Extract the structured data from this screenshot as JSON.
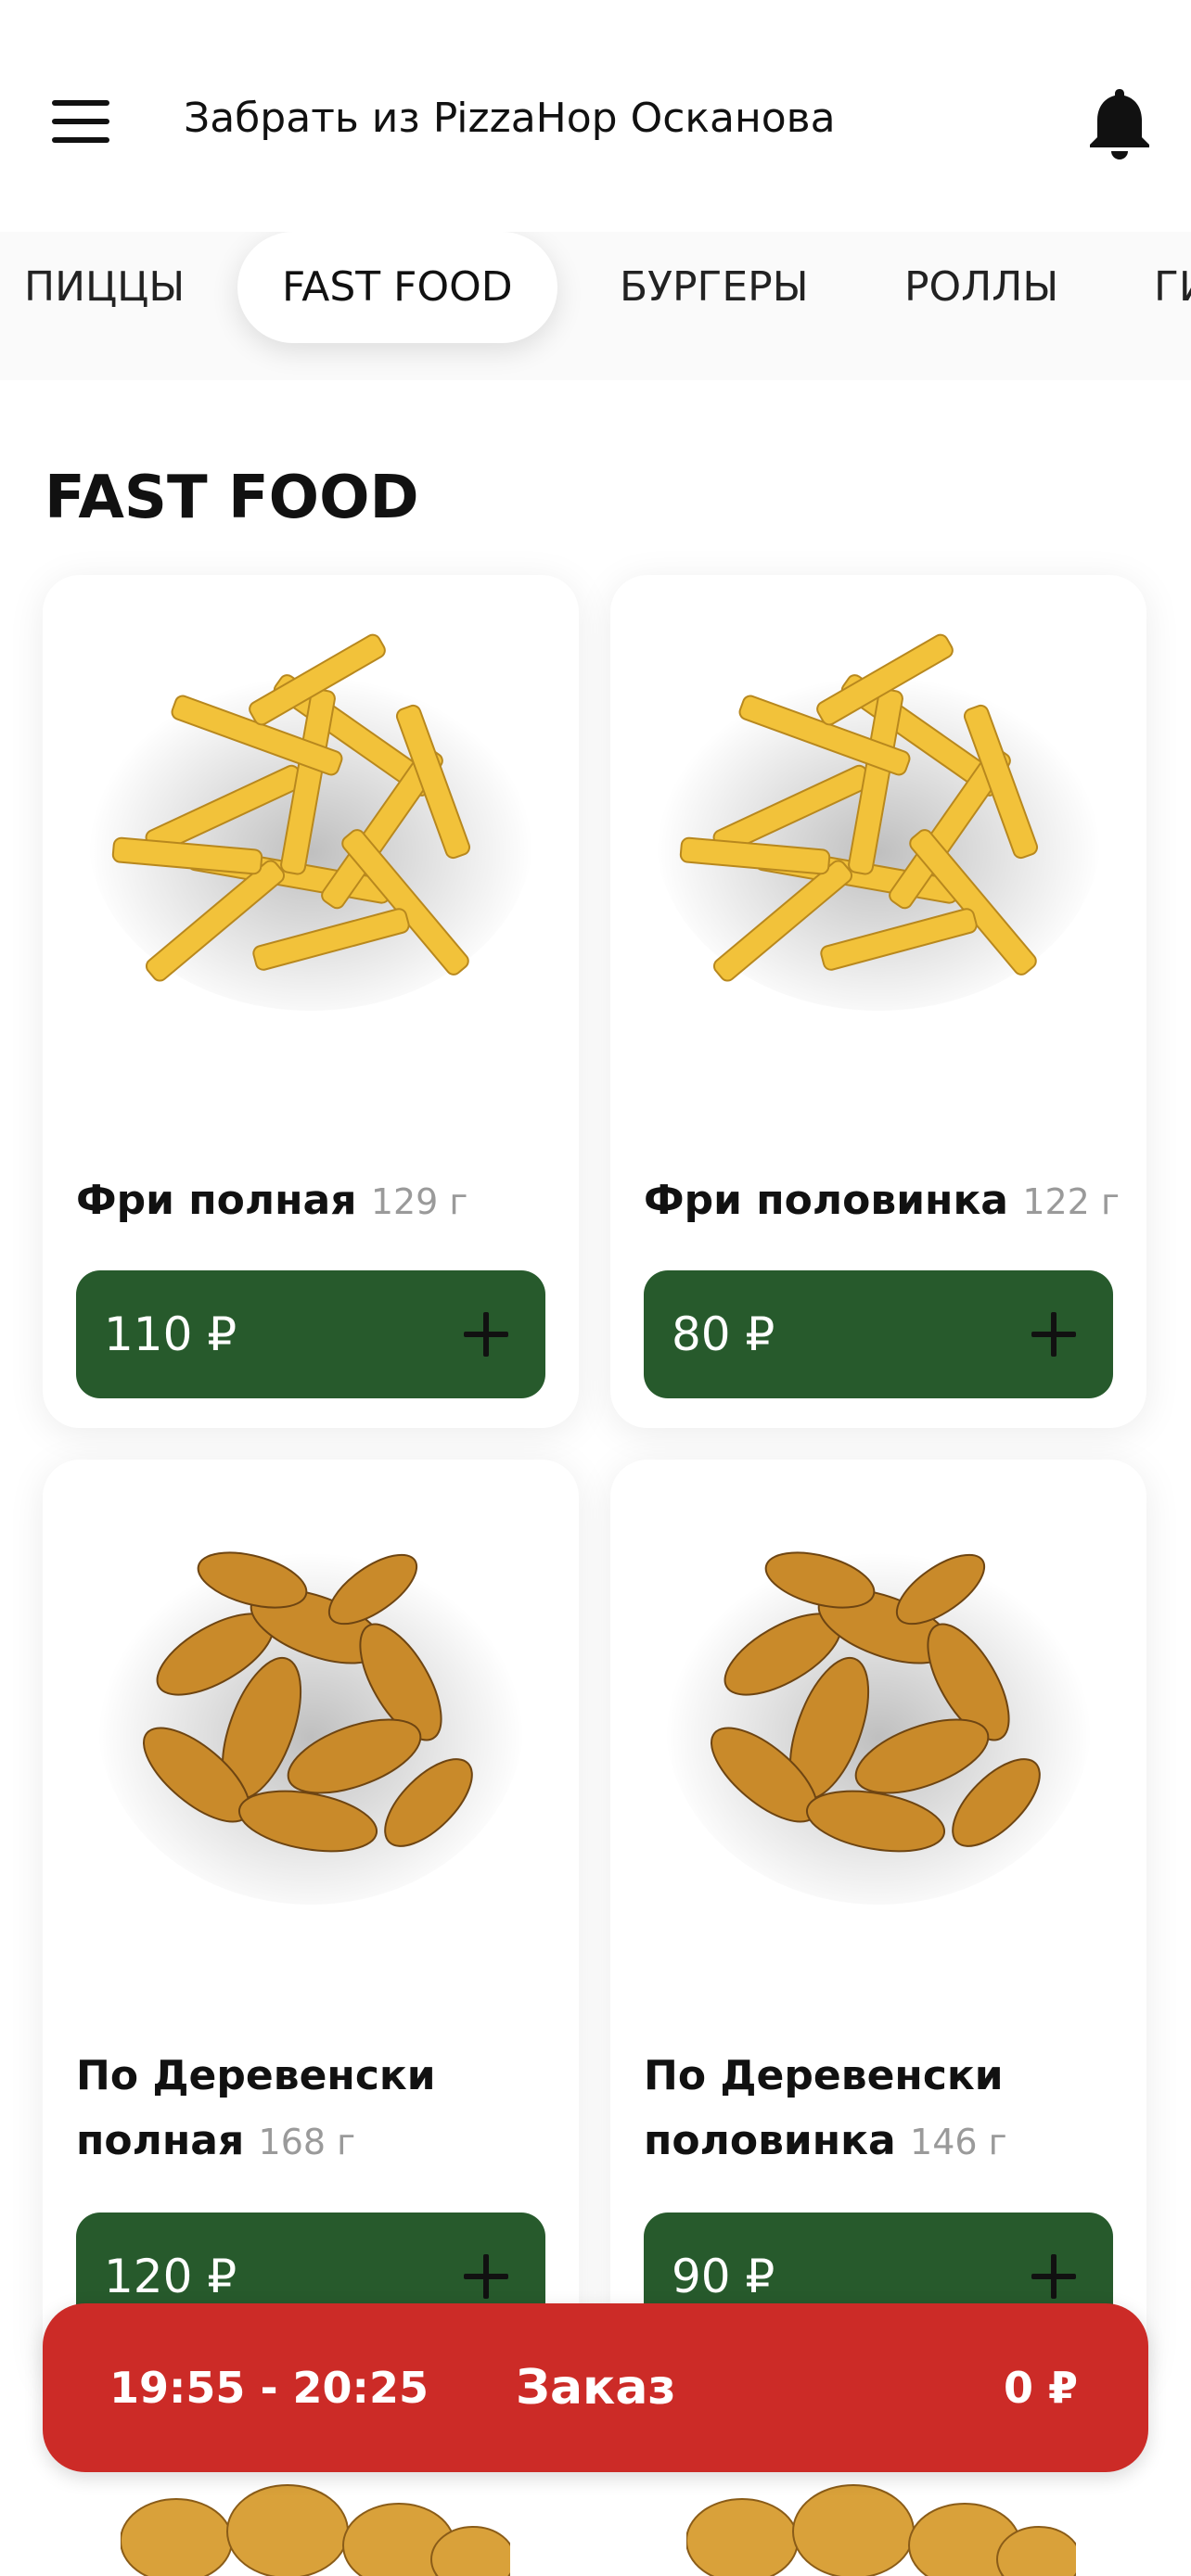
{
  "header": {
    "title": "Забрать из PizzaНор Осканова",
    "menu_icon": "hamburger-menu-icon",
    "bell_icon": "bell-icon"
  },
  "tabs": [
    {
      "label": "ПИЦЦЫ"
    },
    {
      "label": "FAST FOOD",
      "active": true
    },
    {
      "label": "БУРГЕРЫ"
    },
    {
      "label": "РОЛЛЫ"
    },
    {
      "label": "ГИ"
    }
  ],
  "section": {
    "title": "FAST FOOD"
  },
  "products": [
    {
      "name": "Фри полная",
      "weight": "129 г",
      "price": "110 ₽"
    },
    {
      "name": "Фри половинка",
      "weight": "122 г",
      "price": "80 ₽"
    },
    {
      "name": "По Деревенски полная",
      "weight": "168 г",
      "price": "120 ₽"
    },
    {
      "name": "По Деревенски половинка",
      "weight": "146 г",
      "price": "90 ₽"
    }
  ],
  "order_bar": {
    "time": "19:55 - 20:25",
    "label": "Заказ",
    "total": "0 ₽"
  },
  "colors": {
    "accent_green": "#275a2c",
    "order_red": "#cc2b27",
    "fries": "#f2c23a",
    "wedges": "#c98a2a"
  }
}
